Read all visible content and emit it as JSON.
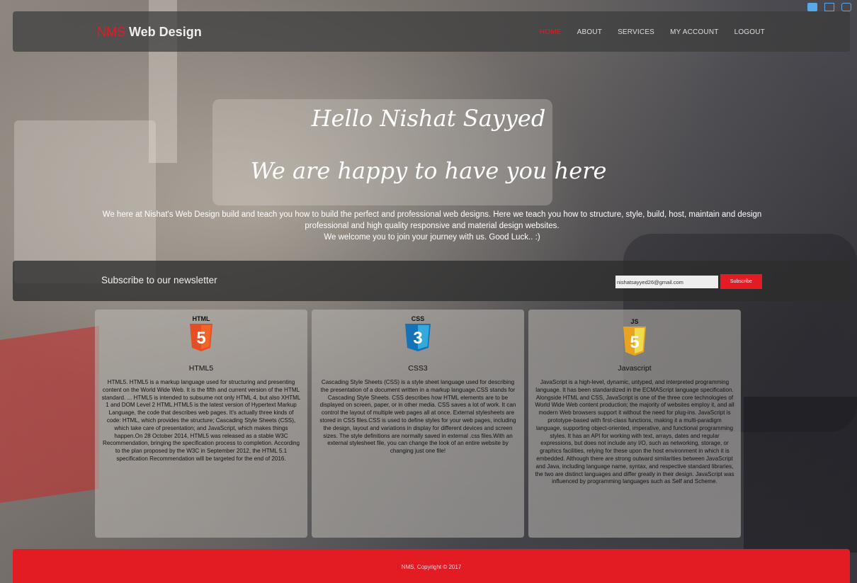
{
  "brand": {
    "accent": "NMS",
    "name": " Web Design"
  },
  "nav": {
    "items": [
      {
        "label": "HOME",
        "active": true
      },
      {
        "label": "ABOUT"
      },
      {
        "label": "SERVICES"
      },
      {
        "label": "MY ACCOUNT"
      },
      {
        "label": "LOGOUT"
      }
    ]
  },
  "hero": {
    "greeting": "Hello Nishat Sayyed",
    "tagline": "We are happy to have you here",
    "intro_line1": "We here at Nishat's Web Design build and teach you how to build the perfect and professional web designs. Here we teach you how to structure, style, build, host, maintain and design professional and high quality responsive and material design websites.",
    "intro_line2": "We welcome you to join your journey with us. Good Luck.. :)"
  },
  "newsletter": {
    "title": "Subscribe to our newsletter",
    "email_value": "nishatsayyed26@gmail.com",
    "button_label": "Subscribe"
  },
  "cards": [
    {
      "icon": "html5-icon",
      "logo_text": "HTML",
      "logo_digit": "5",
      "title": "HTML5",
      "text": "HTML5. HTML5 is a markup language used for structuring and presenting content on the World Wide Web. It is the fifth and current version of the HTML standard. ... HTML5 is intended to subsume not only HTML 4, but also XHTML 1 and DOM Level 2 HTML.HTML5 is the latest version of Hypertext Markup Language, the code that describes web pages. It's actually three kinds of code: HTML, which provides the structure; Cascading Style Sheets (CSS), which take care of presentation; and JavaScript, which makes things happen.On 28 October 2014, HTML5 was released as a stable W3C Recommendation, bringing the specification process to completion. According to the plan proposed by the W3C in September 2012, the HTML 5.1 specification Recommendation will be targeted for the end of 2016."
    },
    {
      "icon": "css3-icon",
      "logo_text": "CSS",
      "logo_digit": "3",
      "title": "CSS3",
      "text": "Cascading Style Sheets (CSS) is a style sheet language used for describing the presentation of a document written in a markup language.CSS stands for Cascading Style Sheets. CSS describes how HTML elements are to be displayed on screen, paper, or in other media. CSS saves a lot of work. It can control the layout of multiple web pages all at once. External stylesheets are stored in CSS files.CSS is used to define styles for your web pages, including the design, layout and variations in display for different devices and screen sizes. The style definitions are normally saved in external .css files.With an external stylesheet file, you can change the look of an entire website by changing just one file!"
    },
    {
      "icon": "javascript-icon",
      "logo_text": "JS",
      "logo_digit": "5",
      "title": "Javascript",
      "text": "JavaScript is a high-level, dynamic, untyped, and interpreted programming language. It has been standardized in the ECMAScript language specification. Alongside HTML and CSS, JavaScript is one of the three core technologies of World Wide Web content production; the majority of websites employ it, and all modern Web browsers support it without the need for plug-ins. JavaScript is prototype-based with first-class functions, making it a multi-paradigm language, supporting object-oriented, imperative, and functional programming styles. It has an API for working with text, arrays, dates and regular expressions, but does not include any I/O, such as networking, storage, or graphics facilities, relying for these upon the host environment in which it is embedded. Although there are strong outward similarities between JavaScript and Java, including language name, syntax, and respective standard libraries, the two are distinct languages and differ greatly in their design. JavaScript was influenced by programming languages such as Self and Scheme."
    }
  ],
  "footer": {
    "copyright": "NMS, Copyright © 2017"
  },
  "colors": {
    "accent": "#e31b23",
    "html5": "#e44d26",
    "css3": "#1572b6",
    "js": "#f0db4f"
  }
}
